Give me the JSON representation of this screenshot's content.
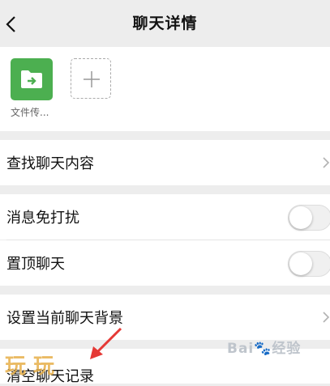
{
  "header": {
    "title": "聊天详情"
  },
  "members": {
    "file_transfer_label": "文件传..."
  },
  "rows": {
    "search_history": "查找聊天内容",
    "mute": "消息免打扰",
    "pin": "置顶聊天",
    "background": "设置当前聊天背景",
    "clear_history": "清空聊天记录"
  },
  "toggles": {
    "mute_on": false,
    "pin_on": false
  },
  "watermarks": {
    "left": "玩 玩",
    "baidu": "Bai🐾经验"
  },
  "colors": {
    "accent_green": "#4caf50",
    "annotation_red": "#e53935",
    "bg": "#ededed"
  }
}
